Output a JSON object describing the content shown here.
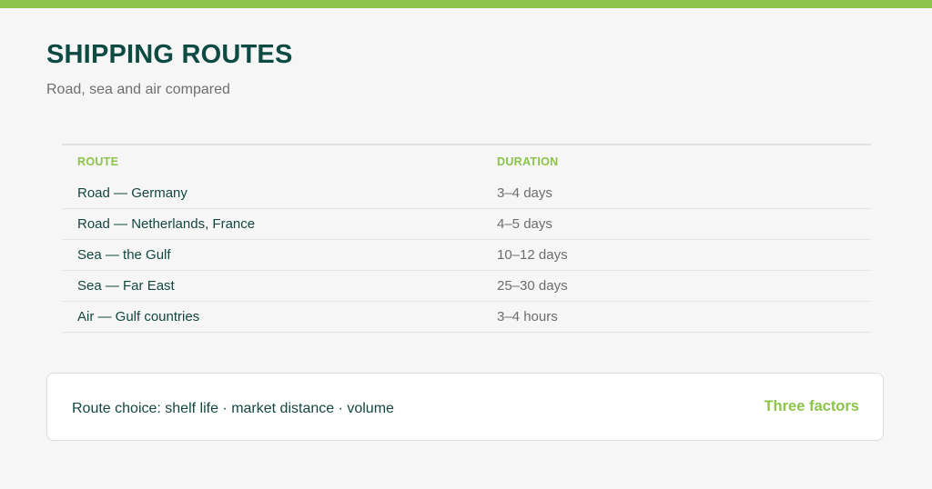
{
  "colors": {
    "accent": "#8cc34a",
    "title": "#0d4a43",
    "text_dark": "#13473f",
    "text_muted": "#6d6d6d",
    "background": "#f6f6f6"
  },
  "header": {
    "title": "SHIPPING ROUTES",
    "subtitle": "Road, sea and air compared"
  },
  "table": {
    "columns": [
      "ROUTE",
      "DURATION"
    ],
    "rows": [
      {
        "route": "Road — Germany",
        "duration": "3–4 days"
      },
      {
        "route": "Road — Netherlands, France",
        "duration": "4–5 days"
      },
      {
        "route": "Sea — the Gulf",
        "duration": "10–12 days"
      },
      {
        "route": "Sea — Far East",
        "duration": "25–30 days"
      },
      {
        "route": "Air — Gulf countries",
        "duration": "3–4 hours"
      }
    ]
  },
  "footer_card": {
    "text": "Route choice: shelf life · market distance · volume",
    "tag": "Three factors"
  }
}
